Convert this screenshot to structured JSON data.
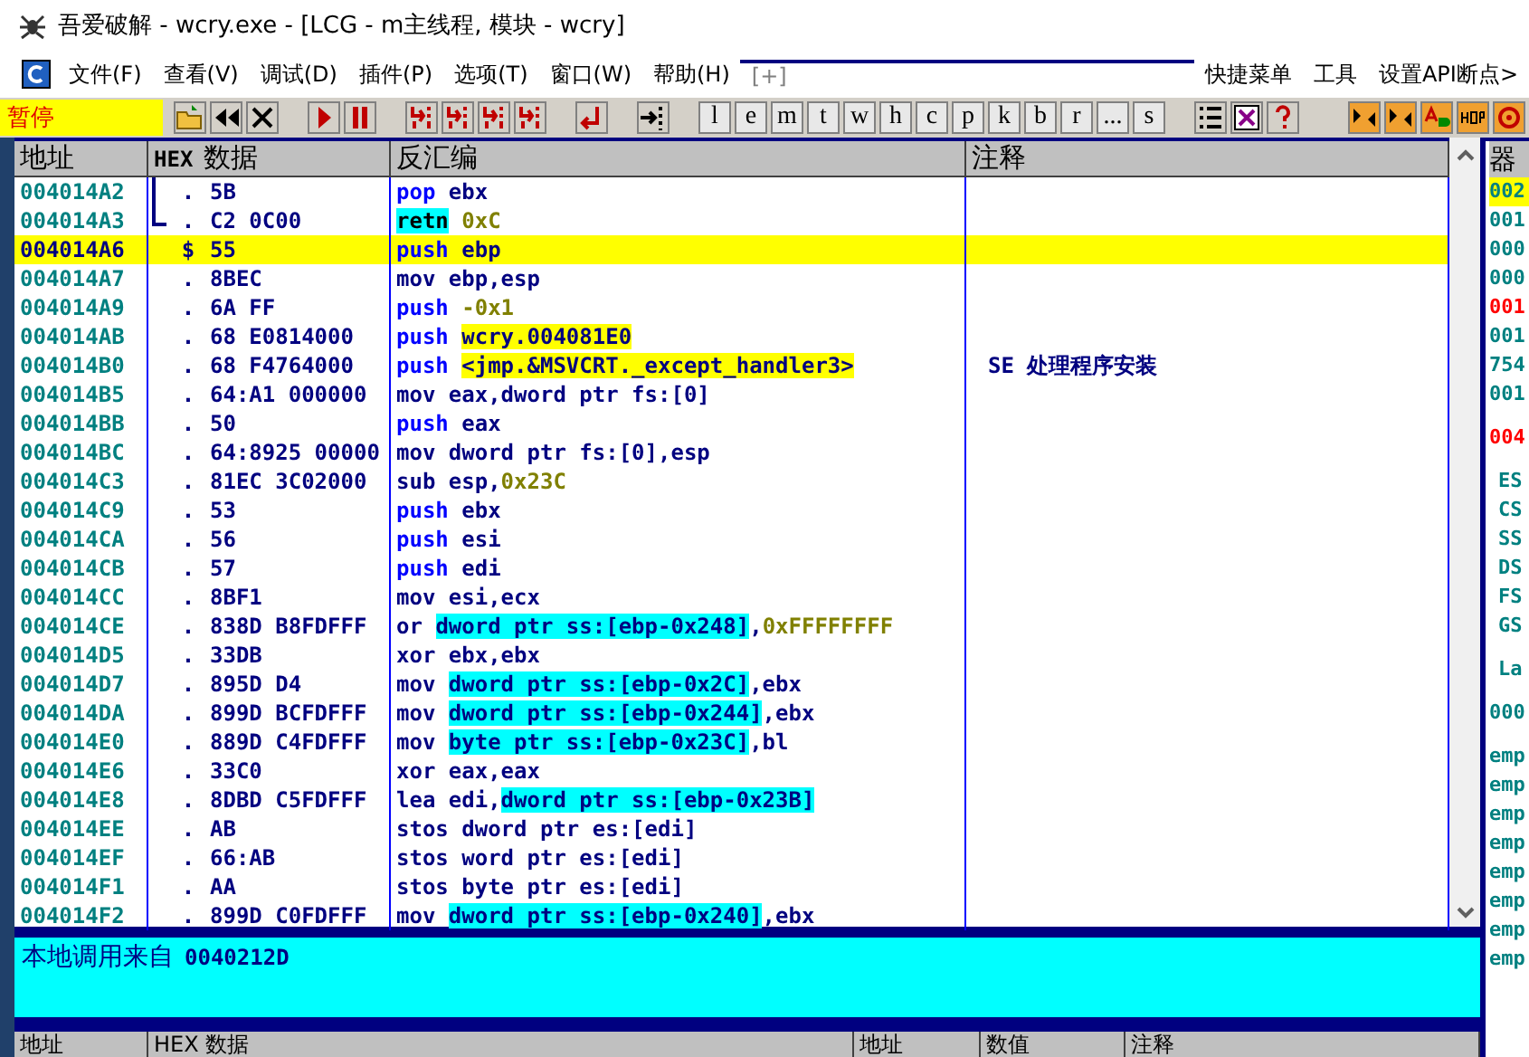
{
  "window": {
    "title": "吾爱破解 - wcry.exe - [LCG - m主线程, 模块 - wcry]"
  },
  "menu": [
    {
      "label": "文件(F)",
      "disabled": false
    },
    {
      "label": "查看(V)",
      "disabled": false
    },
    {
      "label": "调试(D)",
      "disabled": false
    },
    {
      "label": "插件(P)",
      "disabled": false
    },
    {
      "label": "选项(T)",
      "disabled": false
    },
    {
      "label": "窗口(W)",
      "disabled": false
    },
    {
      "label": "帮助(H)",
      "disabled": false
    },
    {
      "label": "[+]",
      "disabled": true
    },
    {
      "label": "快捷菜单",
      "disabled": false
    },
    {
      "label": "工具",
      "disabled": false
    },
    {
      "label": "设置API断点>",
      "disabled": false
    }
  ],
  "toolbar": {
    "status": "暂停",
    "letter_buttons": [
      "l",
      "e",
      "m",
      "t",
      "w",
      "h",
      "c",
      "p",
      "k",
      "b",
      "r",
      "...",
      "s"
    ]
  },
  "disassembly": {
    "columns": [
      "地址",
      "HEX",
      "数据",
      "反汇编",
      "注释"
    ],
    "rows": [
      {
        "address": "004014A2",
        "kind": "bracket-line",
        "marker": ".",
        "hex": "5B",
        "selected": false,
        "code": [
          {
            "kind": "kw",
            "text": "pop"
          },
          {
            "kind": "plain",
            "text": " ebx"
          }
        ]
      },
      {
        "address": "004014A3",
        "kind": "bracket-end",
        "marker": ".",
        "hex": "C2 0C00",
        "selected": false,
        "code": [
          {
            "kind": "ret",
            "text": "retn"
          },
          {
            "kind": "const",
            "text": " 0xC"
          }
        ]
      },
      {
        "address": "004014A6",
        "kind": "plain",
        "marker": "$",
        "hex": "55",
        "selected": true,
        "code": [
          {
            "kind": "kw",
            "text": "push"
          },
          {
            "kind": "plain",
            "text": " ebp"
          }
        ]
      },
      {
        "address": "004014A7",
        "kind": "plain",
        "marker": ".",
        "hex": "8BEC",
        "selected": false,
        "code": [
          {
            "kind": "plain",
            "text": "mov ebp,esp"
          }
        ]
      },
      {
        "address": "004014A9",
        "kind": "plain",
        "marker": ".",
        "hex": "6A FF",
        "selected": false,
        "code": [
          {
            "kind": "kw",
            "text": "push "
          },
          {
            "kind": "const",
            "text": "-0x1"
          }
        ]
      },
      {
        "address": "004014AB",
        "kind": "plain",
        "marker": ".",
        "hex": "68 E0814000",
        "selected": false,
        "code": [
          {
            "kind": "kw",
            "text": "push "
          },
          {
            "kind": "label",
            "text": "wcry.004081E0"
          }
        ]
      },
      {
        "address": "004014B0",
        "kind": "plain",
        "marker": ".",
        "hex": "68 F4764000",
        "selected": false,
        "code": [
          {
            "kind": "kw",
            "text": "push "
          },
          {
            "kind": "label",
            "text": "<jmp.&MSVCRT._except_handler3>"
          }
        ],
        "comment": "SE 处理程序安装"
      },
      {
        "address": "004014B5",
        "kind": "plain",
        "marker": ".",
        "hex": "64:A1 000000",
        "selected": false,
        "code": [
          {
            "kind": "plain",
            "text": "mov eax,dword ptr fs:[0]"
          }
        ]
      },
      {
        "address": "004014BB",
        "kind": "plain",
        "marker": ".",
        "hex": "50",
        "selected": false,
        "code": [
          {
            "kind": "kw",
            "text": "push"
          },
          {
            "kind": "plain",
            "text": " eax"
          }
        ]
      },
      {
        "address": "004014BC",
        "kind": "plain",
        "marker": ".",
        "hex": "64:8925 00000",
        "selected": false,
        "code": [
          {
            "kind": "plain",
            "text": "mov dword ptr fs:[0],esp"
          }
        ]
      },
      {
        "address": "004014C3",
        "kind": "plain",
        "marker": ".",
        "hex": "81EC 3C02000",
        "selected": false,
        "code": [
          {
            "kind": "plain",
            "text": "sub esp,"
          },
          {
            "kind": "const",
            "text": "0x23C"
          }
        ]
      },
      {
        "address": "004014C9",
        "kind": "plain",
        "marker": ".",
        "hex": "53",
        "selected": false,
        "code": [
          {
            "kind": "kw",
            "text": "push"
          },
          {
            "kind": "plain",
            "text": " ebx"
          }
        ]
      },
      {
        "address": "004014CA",
        "kind": "plain",
        "marker": ".",
        "hex": "56",
        "selected": false,
        "code": [
          {
            "kind": "kw",
            "text": "push"
          },
          {
            "kind": "plain",
            "text": " esi"
          }
        ]
      },
      {
        "address": "004014CB",
        "kind": "plain",
        "marker": ".",
        "hex": "57",
        "selected": false,
        "code": [
          {
            "kind": "kw",
            "text": "push"
          },
          {
            "kind": "plain",
            "text": " edi"
          }
        ]
      },
      {
        "address": "004014CC",
        "kind": "plain",
        "marker": ".",
        "hex": "8BF1",
        "selected": false,
        "code": [
          {
            "kind": "plain",
            "text": "mov esi,ecx"
          }
        ]
      },
      {
        "address": "004014CE",
        "kind": "plain",
        "marker": ".",
        "hex": "838D B8FDFFF",
        "selected": false,
        "code": [
          {
            "kind": "plain",
            "text": "or "
          },
          {
            "kind": "mem",
            "text": "dword ptr ss:[ebp-0x248]"
          },
          {
            "kind": "plain",
            "text": ","
          },
          {
            "kind": "const",
            "text": "0xFFFFFFFF"
          }
        ]
      },
      {
        "address": "004014D5",
        "kind": "plain",
        "marker": ".",
        "hex": "33DB",
        "selected": false,
        "code": [
          {
            "kind": "plain",
            "text": "xor ebx,ebx"
          }
        ]
      },
      {
        "address": "004014D7",
        "kind": "plain",
        "marker": ".",
        "hex": "895D D4",
        "selected": false,
        "code": [
          {
            "kind": "plain",
            "text": "mov "
          },
          {
            "kind": "mem",
            "text": "dword ptr ss:[ebp-0x2C]"
          },
          {
            "kind": "plain",
            "text": ",ebx"
          }
        ]
      },
      {
        "address": "004014DA",
        "kind": "plain",
        "marker": ".",
        "hex": "899D BCFDFFF",
        "selected": false,
        "code": [
          {
            "kind": "plain",
            "text": "mov "
          },
          {
            "kind": "mem",
            "text": "dword ptr ss:[ebp-0x244]"
          },
          {
            "kind": "plain",
            "text": ",ebx"
          }
        ]
      },
      {
        "address": "004014E0",
        "kind": "plain",
        "marker": ".",
        "hex": "889D C4FDFFF",
        "selected": false,
        "code": [
          {
            "kind": "plain",
            "text": "mov "
          },
          {
            "kind": "mem",
            "text": "byte ptr ss:[ebp-0x23C]"
          },
          {
            "kind": "plain",
            "text": ",bl"
          }
        ]
      },
      {
        "address": "004014E6",
        "kind": "plain",
        "marker": ".",
        "hex": "33C0",
        "selected": false,
        "code": [
          {
            "kind": "plain",
            "text": "xor eax,eax"
          }
        ]
      },
      {
        "address": "004014E8",
        "kind": "plain",
        "marker": ".",
        "hex": "8DBD C5FDFFF",
        "selected": false,
        "code": [
          {
            "kind": "plain",
            "text": "lea edi,"
          },
          {
            "kind": "mem",
            "text": "dword ptr ss:[ebp-0x23B]"
          }
        ]
      },
      {
        "address": "004014EE",
        "kind": "plain",
        "marker": ".",
        "hex": "AB",
        "selected": false,
        "code": [
          {
            "kind": "plain",
            "text": "stos dword ptr es:[edi]"
          }
        ]
      },
      {
        "address": "004014EF",
        "kind": "plain",
        "marker": ".",
        "hex": "66:AB",
        "selected": false,
        "code": [
          {
            "kind": "plain",
            "text": "stos word ptr es:[edi]"
          }
        ]
      },
      {
        "address": "004014F1",
        "kind": "plain",
        "marker": ".",
        "hex": "AA",
        "selected": false,
        "code": [
          {
            "kind": "plain",
            "text": "stos byte ptr es:[edi]"
          }
        ]
      },
      {
        "address": "004014F2",
        "kind": "plain",
        "marker": ".",
        "hex": "899D C0FDFFF",
        "selected": false,
        "code": [
          {
            "kind": "plain",
            "text": "mov "
          },
          {
            "kind": "mem",
            "text": "dword ptr ss:[ebp-0x240]"
          },
          {
            "kind": "plain",
            "text": ",ebx"
          }
        ]
      }
    ]
  },
  "registers": {
    "title": "器",
    "items": [
      {
        "text": "002",
        "changed": false,
        "selected": true,
        "kind": "value"
      },
      {
        "text": "001",
        "changed": false,
        "selected": false,
        "kind": "value"
      },
      {
        "text": "000",
        "changed": false,
        "selected": false,
        "kind": "value"
      },
      {
        "text": "000",
        "changed": false,
        "selected": false,
        "kind": "value"
      },
      {
        "text": "001",
        "changed": true,
        "selected": false,
        "kind": "value"
      },
      {
        "text": "001",
        "changed": false,
        "selected": false,
        "kind": "value"
      },
      {
        "text": "754",
        "changed": false,
        "selected": false,
        "kind": "value"
      },
      {
        "text": "001",
        "changed": false,
        "selected": false,
        "kind": "value"
      },
      {
        "text": "004",
        "changed": true,
        "selected": false,
        "kind": "gap-value"
      },
      {
        "text": "ES",
        "changed": false,
        "selected": false,
        "kind": "gap-seg"
      },
      {
        "text": "CS",
        "changed": false,
        "selected": false,
        "kind": "seg"
      },
      {
        "text": "SS",
        "changed": false,
        "selected": false,
        "kind": "seg"
      },
      {
        "text": "DS",
        "changed": false,
        "selected": false,
        "kind": "seg"
      },
      {
        "text": "FS",
        "changed": false,
        "selected": false,
        "kind": "seg"
      },
      {
        "text": "GS",
        "changed": false,
        "selected": false,
        "kind": "seg"
      },
      {
        "text": "La",
        "changed": false,
        "selected": false,
        "kind": "gap-seg"
      },
      {
        "text": "000",
        "changed": false,
        "selected": false,
        "kind": "gap-value"
      },
      {
        "text": "emp",
        "changed": false,
        "selected": false,
        "kind": "gap-value"
      },
      {
        "text": "emp",
        "changed": false,
        "selected": false,
        "kind": "value"
      },
      {
        "text": "emp",
        "changed": false,
        "selected": false,
        "kind": "value"
      },
      {
        "text": "emp",
        "changed": false,
        "selected": false,
        "kind": "value"
      },
      {
        "text": "emp",
        "changed": false,
        "selected": false,
        "kind": "value"
      },
      {
        "text": "emp",
        "changed": false,
        "selected": false,
        "kind": "value"
      },
      {
        "text": "emp",
        "changed": false,
        "selected": false,
        "kind": "value"
      },
      {
        "text": "emp",
        "changed": false,
        "selected": false,
        "kind": "value"
      }
    ]
  },
  "info": {
    "label": "本地调用来自",
    "address": "0040212D"
  },
  "dump_headers": {
    "left": [
      "地址",
      "HEX 数据"
    ],
    "right": [
      "地址",
      "数值",
      "注释"
    ]
  }
}
